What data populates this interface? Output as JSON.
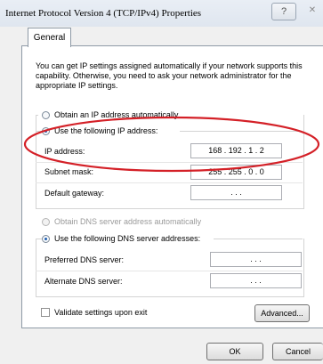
{
  "window": {
    "title": "Internet Protocol Version 4 (TCP/IPv4) Properties",
    "help_glyph": "?",
    "close_glyph": "✕"
  },
  "tabs": [
    {
      "label": "General"
    }
  ],
  "description": "You can get IP settings assigned automatically if your network supports this capability. Otherwise, you need to ask your network administrator for the appropriate IP settings.",
  "ip_section": {
    "auto_label": "Obtain an IP address automatically",
    "manual_label": "Use the following IP address:",
    "selected": "manual",
    "fields": [
      {
        "label": "IP address:",
        "value": "168 . 192 . 1 . 2"
      },
      {
        "label": "Subnet mask:",
        "value": "255 . 255 . 0 . 0"
      },
      {
        "label": "Default gateway:",
        "value": ". . ."
      }
    ]
  },
  "dns_section": {
    "auto_label": "Obtain DNS server address automatically",
    "manual_label": "Use the following DNS server addresses:",
    "selected": "manual",
    "fields": [
      {
        "label": "Preferred DNS server:",
        "value": ". . ."
      },
      {
        "label": "Alternate DNS server:",
        "value": ". . ."
      }
    ]
  },
  "validate_label": "Validate settings upon exit",
  "validate_checked": false,
  "buttons": {
    "advanced": "Advanced...",
    "ok": "OK",
    "cancel": "Cancel"
  },
  "colors": {
    "annotation": "#d42027",
    "accent": "#1f5fb3"
  }
}
